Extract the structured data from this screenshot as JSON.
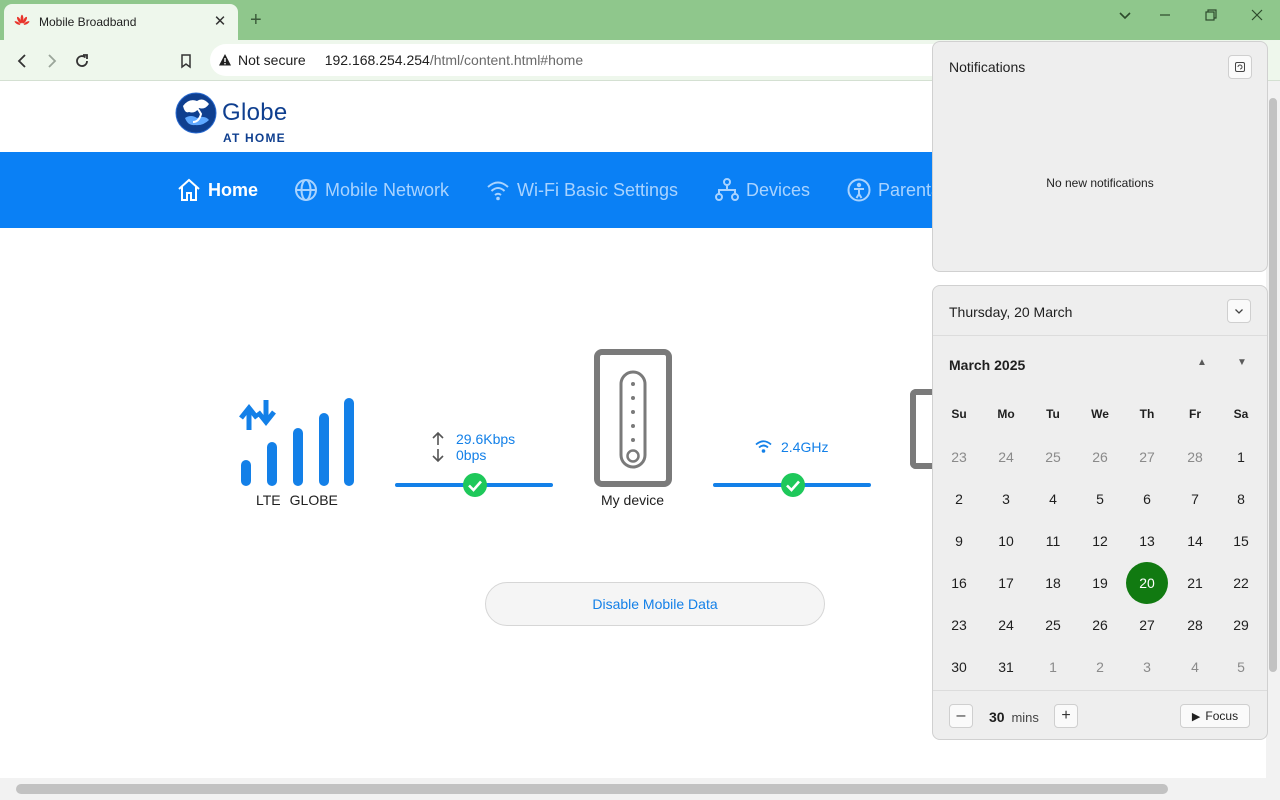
{
  "browser": {
    "tab_title": "Mobile Broadband",
    "tab_close": "✕",
    "new_tab": "+",
    "security_label": "Not secure",
    "url_host": "192.168.254.254",
    "url_path": "/html/content.html#home",
    "window_controls": {
      "list": "⌄",
      "minimize": "–",
      "restore": "❐",
      "close": "✕"
    }
  },
  "brand": {
    "name": "Globe",
    "tagline": "AT HOME",
    "color": "#0f3f8f"
  },
  "menu": {
    "color": "#0a80f5",
    "items": [
      {
        "label": "Home",
        "icon": "home-icon",
        "active": true
      },
      {
        "label": "Mobile Network",
        "icon": "globe-icon",
        "active": false
      },
      {
        "label": "Wi-Fi Basic Settings",
        "icon": "wifi-icon",
        "active": false
      },
      {
        "label": "Devices",
        "icon": "devices-icon",
        "active": false
      },
      {
        "label": "Parenta",
        "icon": "parental-icon",
        "active": false
      }
    ]
  },
  "status": {
    "network_type": "LTE",
    "operator": "GLOBE",
    "upload_rate": "29.6Kbps",
    "download_rate": "0bps",
    "device_label": "My device",
    "wifi_band": "2.4GHz",
    "link_color": "#1380e8",
    "ok_color": "#1ec85a",
    "signal_bars": 4
  },
  "actions": {
    "disable_mobile_data": "Disable Mobile Data"
  },
  "notifications": {
    "title": "Notifications",
    "empty_text": "No new notifications"
  },
  "calendar": {
    "current_date": "Thursday, 20 March",
    "month_label": "March 2025",
    "weekdays": [
      "Su",
      "Mo",
      "Tu",
      "We",
      "Th",
      "Fr",
      "Sa"
    ],
    "weeks": [
      [
        "23",
        "24",
        "25",
        "26",
        "27",
        "28",
        "1"
      ],
      [
        "2",
        "3",
        "4",
        "5",
        "6",
        "7",
        "8"
      ],
      [
        "9",
        "10",
        "11",
        "12",
        "13",
        "14",
        "15"
      ],
      [
        "16",
        "17",
        "18",
        "19",
        "20",
        "21",
        "22"
      ],
      [
        "23",
        "24",
        "25",
        "26",
        "27",
        "28",
        "29"
      ],
      [
        "30",
        "31",
        "1",
        "2",
        "3",
        "4",
        "5"
      ]
    ],
    "today": "20",
    "today_color": "#117a11"
  },
  "focus": {
    "minutes": "30",
    "unit": "mins",
    "button": "Focus",
    "minus": "–",
    "plus": "+"
  }
}
